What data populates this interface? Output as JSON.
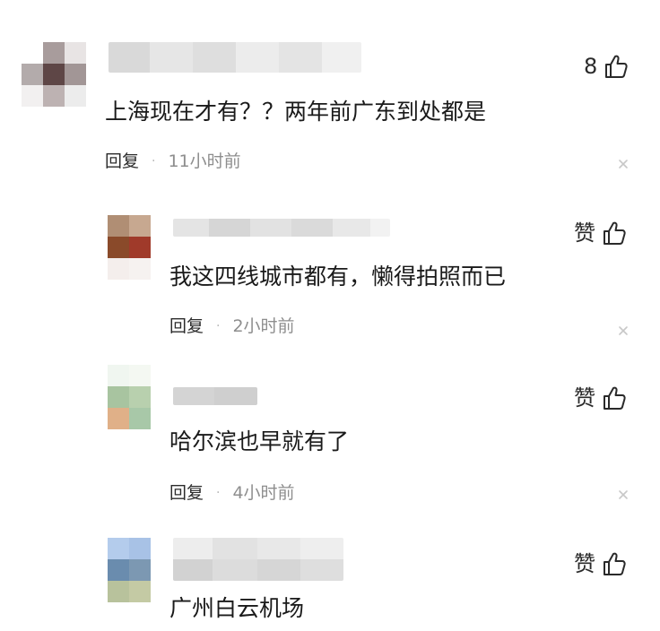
{
  "comments": [
    {
      "text": "上海现在才有？？两年前广东到处都是",
      "reply_label": "回复",
      "time": "11小时前",
      "like_label": "8"
    },
    {
      "text": "我这四线城市都有，懒得拍照而已",
      "reply_label": "回复",
      "time": "2小时前",
      "like_label": "赞"
    },
    {
      "text": "哈尔滨也早就有了",
      "reply_label": "回复",
      "time": "4小时前",
      "like_label": "赞"
    },
    {
      "text": "广州白云机场",
      "like_label": "赞"
    }
  ],
  "separator": "·",
  "icons": {
    "like": "thumbs-up-icon",
    "close": "close-icon"
  },
  "colors": {
    "text": "#1a1a1a",
    "meta": "#8e8e8e",
    "close": "#c8c8c8"
  }
}
